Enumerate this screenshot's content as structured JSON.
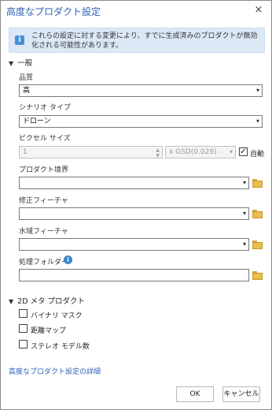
{
  "dialog": {
    "title": "高度なプロダクト設定",
    "close_icon": "×"
  },
  "info_banner": {
    "icon": "info-icon",
    "text": "これらの設定に対する変更により、すでに生成済みのプロダクトが無効化される可能性があります。"
  },
  "general": {
    "header": "一般",
    "quality": {
      "label": "品質",
      "value": "高"
    },
    "scenario_type": {
      "label": "シナリオ タイプ",
      "value": "ドローン"
    },
    "pixel_size": {
      "label": "ピクセル サイズ",
      "value": "1",
      "unit": "x GSD(0.029)",
      "auto_label": "自動",
      "auto_checked": true
    },
    "product_boundary": {
      "label": "プロダクト境界",
      "value": ""
    },
    "correction_feature": {
      "label": "修正フィーチャ",
      "value": ""
    },
    "waterbody_feature": {
      "label": "水域フィーチャ",
      "value": ""
    },
    "processing_folder": {
      "label": "処理フォルダー",
      "value": ""
    }
  },
  "meta_2d": {
    "header": "2D メタ プロダクト",
    "options": [
      {
        "label": "バイナリ マスク",
        "checked": false
      },
      {
        "label": "距離マップ",
        "checked": false
      },
      {
        "label": "ステレオ モデル数",
        "checked": false
      }
    ]
  },
  "footer": {
    "link": "高度なプロダクト設定の詳細",
    "ok": "OK",
    "cancel": "キャンセル"
  }
}
